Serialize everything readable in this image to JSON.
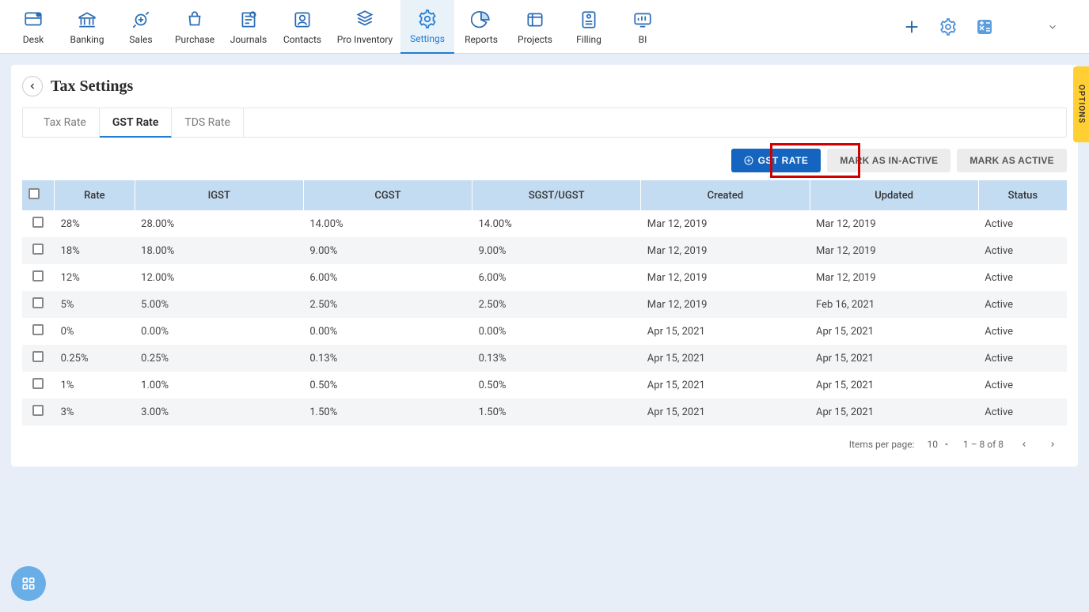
{
  "topnav": {
    "items": [
      {
        "label": "Desk"
      },
      {
        "label": "Banking"
      },
      {
        "label": "Sales"
      },
      {
        "label": "Purchase"
      },
      {
        "label": "Journals"
      },
      {
        "label": "Contacts"
      },
      {
        "label": "Pro Inventory"
      },
      {
        "label": "Settings"
      },
      {
        "label": "Reports"
      },
      {
        "label": "Projects"
      },
      {
        "label": "Filling"
      },
      {
        "label": "BI"
      }
    ]
  },
  "page": {
    "title": "Tax Settings"
  },
  "tabs": {
    "items": [
      "Tax Rate",
      "GST Rate",
      "TDS Rate"
    ],
    "active": 1
  },
  "actions": {
    "add_label": "GST RATE",
    "inactive_label": "MARK AS IN-ACTIVE",
    "active_label": "MARK AS ACTIVE"
  },
  "table": {
    "headers": [
      "Rate",
      "IGST",
      "CGST",
      "SGST/UGST",
      "Created",
      "Updated",
      "Status"
    ],
    "rows": [
      {
        "rate": "28%",
        "igst": "28.00%",
        "cgst": "14.00%",
        "sgst": "14.00%",
        "created": "Mar 12, 2019",
        "updated": "Mar 12, 2019",
        "status": "Active"
      },
      {
        "rate": "18%",
        "igst": "18.00%",
        "cgst": "9.00%",
        "sgst": "9.00%",
        "created": "Mar 12, 2019",
        "updated": "Mar 12, 2019",
        "status": "Active"
      },
      {
        "rate": "12%",
        "igst": "12.00%",
        "cgst": "6.00%",
        "sgst": "6.00%",
        "created": "Mar 12, 2019",
        "updated": "Mar 12, 2019",
        "status": "Active"
      },
      {
        "rate": "5%",
        "igst": "5.00%",
        "cgst": "2.50%",
        "sgst": "2.50%",
        "created": "Mar 12, 2019",
        "updated": "Feb 16, 2021",
        "status": "Active"
      },
      {
        "rate": "0%",
        "igst": "0.00%",
        "cgst": "0.00%",
        "sgst": "0.00%",
        "created": "Apr 15, 2021",
        "updated": "Apr 15, 2021",
        "status": "Active"
      },
      {
        "rate": "0.25%",
        "igst": "0.25%",
        "cgst": "0.13%",
        "sgst": "0.13%",
        "created": "Apr 15, 2021",
        "updated": "Apr 15, 2021",
        "status": "Active"
      },
      {
        "rate": "1%",
        "igst": "1.00%",
        "cgst": "0.50%",
        "sgst": "0.50%",
        "created": "Apr 15, 2021",
        "updated": "Apr 15, 2021",
        "status": "Active"
      },
      {
        "rate": "3%",
        "igst": "3.00%",
        "cgst": "1.50%",
        "sgst": "1.50%",
        "created": "Apr 15, 2021",
        "updated": "Apr 15, 2021",
        "status": "Active"
      }
    ]
  },
  "pagination": {
    "per_page_label": "Items per page:",
    "per_page_value": "10",
    "range": "1 – 8 of 8"
  },
  "options_tab": "OPTIONS"
}
